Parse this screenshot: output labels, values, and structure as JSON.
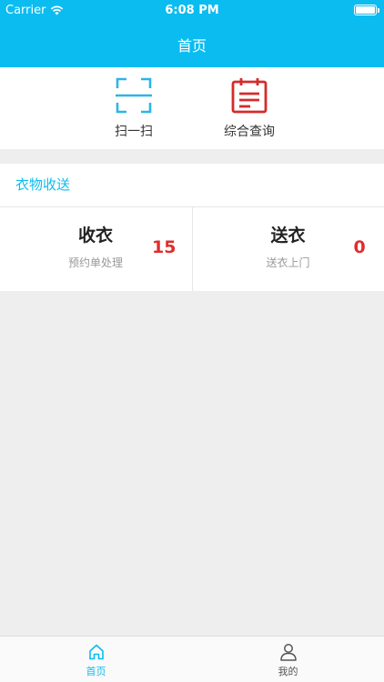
{
  "status_bar": {
    "carrier": "Carrier",
    "time": "6:08 PM"
  },
  "header": {
    "title": "首页"
  },
  "quick_actions": [
    {
      "label": "扫一扫",
      "icon": "scan-icon",
      "color": "#2bb6e6"
    },
    {
      "label": "综合查询",
      "icon": "calendar-list-icon",
      "color": "#d62b2b"
    }
  ],
  "section": {
    "title": "衣物收送",
    "cards": [
      {
        "title": "收衣",
        "subtitle": "预约单处理",
        "count": "15"
      },
      {
        "title": "送衣",
        "subtitle": "送衣上门",
        "count": "0"
      }
    ]
  },
  "tabbar": {
    "active_color": "#0bbcf0",
    "tabs": [
      {
        "label": "首页",
        "icon": "home-icon",
        "active": true
      },
      {
        "label": "我的",
        "icon": "user-icon",
        "active": false
      }
    ]
  }
}
